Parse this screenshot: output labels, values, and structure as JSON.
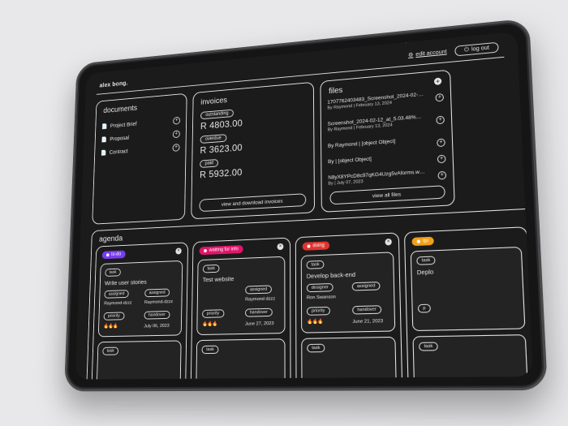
{
  "header": {
    "brand": "alex bong.",
    "edit_account": "edit account",
    "logout": "log out"
  },
  "documents": {
    "title": "documents",
    "items": [
      {
        "label": "Project Brief"
      },
      {
        "label": "Proposal"
      },
      {
        "label": "Contract"
      }
    ]
  },
  "invoices": {
    "title": "invoices",
    "groups": [
      {
        "status": "outstanding",
        "amount": "R 4803.00"
      },
      {
        "status": "overdue",
        "amount": "R 3623.00"
      },
      {
        "status": "paid",
        "amount": "R 5932.00"
      }
    ],
    "button": "view and download invoices"
  },
  "files": {
    "title": "files",
    "items": [
      {
        "name": "1707762403483_Screenshot_2024-02-12_at_5.03.48%25E2%2580%25AFPM.png",
        "meta": "By Raymond | February 13, 2024"
      },
      {
        "name": "Screenshot_2024-02-12_at_5.03.48%E2%80%AFPM.png",
        "meta": "By Raymond | February 13, 2024"
      },
      {
        "name": "By Raymond | [object Object]",
        "meta": ""
      },
      {
        "name": "By | [object Object]",
        "meta": ""
      },
      {
        "name": "N8yX8YPcD8c97qKG4Uzg5vAforms.webp",
        "meta": "By | July 07, 2023"
      }
    ],
    "button": "view all files"
  },
  "agenda": {
    "title": "agenda",
    "columns": [
      {
        "status": "to-do",
        "color": "#7a3cf2",
        "card": {
          "type": "task",
          "title": "Write user stories",
          "assigned_label": "assigned",
          "assigned_a": "Raymond-dzzz",
          "assigned_b": "Raymond-dzzz",
          "priority_label": "priority",
          "handover_label": "handover",
          "date": "July 06, 2023"
        }
      },
      {
        "status": "waiting for info",
        "color": "#e2156b",
        "card": {
          "type": "task",
          "title": "Test website",
          "assigned_label": "assigned",
          "assigned_a": "Raymond dzzz",
          "priority_label": "priority",
          "handover_label": "handover",
          "date": "June 27, 2023"
        }
      },
      {
        "status": "doing",
        "color": "#e0342f",
        "card": {
          "type": "task",
          "title": "Develop back-end",
          "assigned_label": "designer",
          "assigned_label_b": "assigned",
          "assigned_a": "Ron Swanson",
          "priority_label": "priority",
          "handover_label": "handover",
          "date": "June 21, 2023"
        }
      },
      {
        "status": "qu",
        "color": "#f2a019",
        "card": {
          "type": "task",
          "title": "Deplo",
          "priority_label": "p"
        }
      }
    ],
    "second_card_type": "task"
  },
  "colors": {
    "bg": "#1b1b1b",
    "border": "#e6e6e6",
    "flame": "#f29a2e"
  }
}
